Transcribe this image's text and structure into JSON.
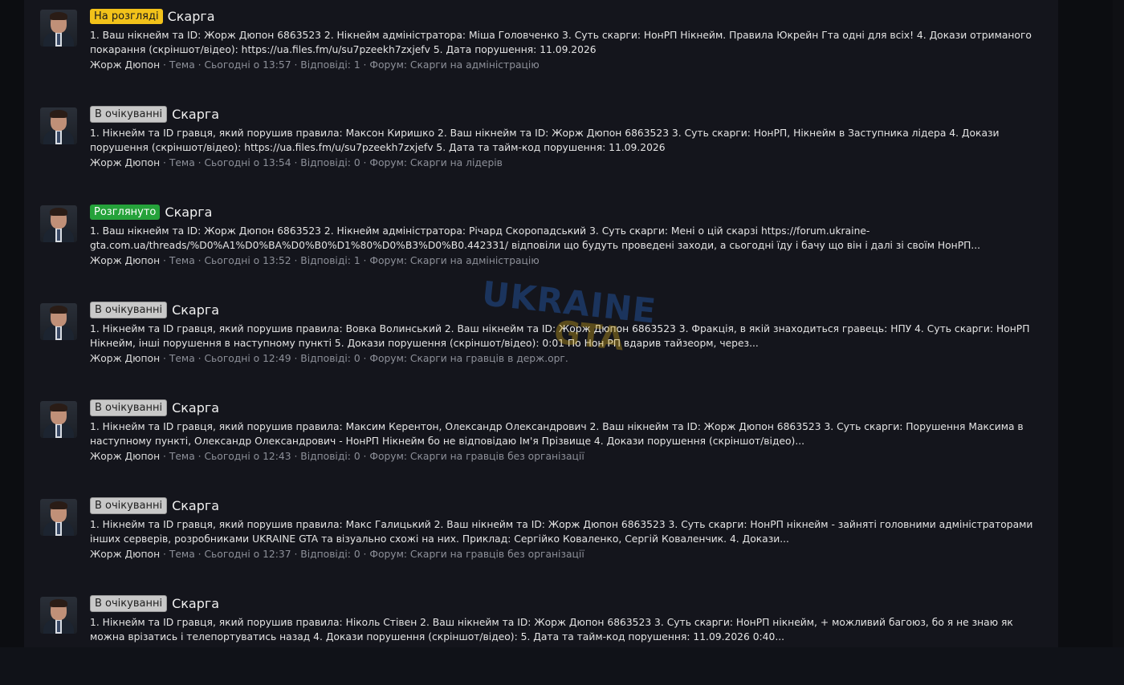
{
  "watermark": {
    "main": "UKRAINE",
    "sub": "GTA"
  },
  "threads": [
    {
      "prefix": "На розгляді",
      "prefix_style": "review",
      "title": "Скарга",
      "snippet": "1. Ваш нікнейм та ID: Жорж Дюпон 6863523 2. Нікнейм адміністратора: Міша Головченко 3. Суть скарги: НонРП Нікнейм. Правила Юкрейн Гта одні для всіх! 4. Докази отриманого\nпокарання (скріншот/відео): https://ua.files.fm/u/su7pzeekh7zxjefv 5. Дата порушення: 11.09.2026",
      "author": "Жорж Дюпон",
      "meta": " · Тема · Сьогодні о 13:57 · Відповіді: 1 · Форум: Скарги на адміністрацію"
    },
    {
      "prefix": "В очікуванні",
      "prefix_style": "pending",
      "title": "Скарга",
      "snippet": "1. Нікнейм та ID гравця, який порушив правила: Максон Киришко 2. Ваш нікнейм та ID: Жорж Дюпон 6863523 3. Суть скарги: НонРП, Нікнейм в Заступника лідера 4. Докази\nпорушення (скріншот/відео): https://ua.files.fm/u/su7pzeekh7zxjefv 5. Дата та тайм-код порушення: 11.09.2026",
      "author": "Жорж Дюпон",
      "meta": " · Тема · Сьогодні о 13:54 · Відповіді: 0 · Форум: Скарги на лідерів"
    },
    {
      "prefix": "Розглянуто",
      "prefix_style": "done",
      "title": "Скарга",
      "snippet": "1. Ваш нікнейм та ID: Жорж Дюпон 6863523 2. Нікнейм адміністратора: Річард Скоропадський 3. Суть скарги: Мені о цій скарзі https://forum.ukraine-\ngta.com.ua/threads/%D0%A1%D0%BA%D0%B0%D1%80%D0%B3%D0%B0.442331/ відповіли що будуть проведені заходи, а сьогодні їду і бачу що він і далі зі своїм НонРП...",
      "author": "Жорж Дюпон",
      "meta": " · Тема · Сьогодні о 13:52 · Відповіді: 1 · Форум: Скарги на адміністрацію"
    },
    {
      "prefix": "В очікуванні",
      "prefix_style": "pending",
      "title": "Скарга",
      "snippet": "1. Нікнейм та ID гравця, який порушив правила: Вовка Волинський 2. Ваш нікнейм та ID: Жорж Дюпон 6863523 3. Фракція, в якій знаходиться гравець: НПУ 4. Суть скарги: НонРП\nНікнейм, інші порушення в наступному пункті 5. Докази порушення (скріншот/відео): 0:01 По Нон РП вдарив тайзеорм, через...",
      "author": "Жорж Дюпон",
      "meta": " · Тема · Сьогодні о 12:49 · Відповіді: 0 · Форум: Скарги на гравців в держ.орг."
    },
    {
      "prefix": "В очікуванні",
      "prefix_style": "pending",
      "title": "Скарга",
      "snippet": "1. Нікнейм та ID гравця, який порушив правила: Максим Керентон, Олександр Олександрович 2. Ваш нікнейм та ID: Жорж Дюпон 6863523 3. Суть скарги: Порушення Максима в\nнаступному пункті, Олександр Олександрович - НонРП Нікнейм бо не відповідаю Ім'я Прізвище 4. Докази порушення (скріншот/відео)...",
      "author": "Жорж Дюпон",
      "meta": " · Тема · Сьогодні о 12:43 · Відповіді: 0 · Форум: Скарги на гравців без організації"
    },
    {
      "prefix": "В очікуванні",
      "prefix_style": "pending",
      "title": "Скарга",
      "snippet": "1. Нікнейм та ID гравця, який порушив правила: Макс Галицький 2. Ваш нікнейм та ID: Жорж Дюпон 6863523 3. Суть скарги: НонРП нікнейм - зайняті головними адміністраторами\nінших серверів, розробниками UKRAINE GTA та візуально схожі на них. Приклад: Сергійко Коваленко, Сергій Коваленчик. 4. Докази...",
      "author": "Жорж Дюпон",
      "meta": " · Тема · Сьогодні о 12:37 · Відповіді: 0 · Форум: Скарги на гравців без організації"
    },
    {
      "prefix": "В очікуванні",
      "prefix_style": "pending",
      "title": "Скарга",
      "snippet": "1. Нікнейм та ID гравця, який порушив правила: Ніколь Стівен 2. Ваш нікнейм та ID: Жорж Дюпон 6863523 3. Суть скарги: НонРП нікнейм, + можливий багоюз, бо я не знаю як\nможна врізатись і телепортуватись назад 4. Докази порушення (скріншот/відео): 5. Дата та тайм-код порушення: 11.09.2026 0:40...",
      "author": "",
      "meta": ""
    }
  ]
}
